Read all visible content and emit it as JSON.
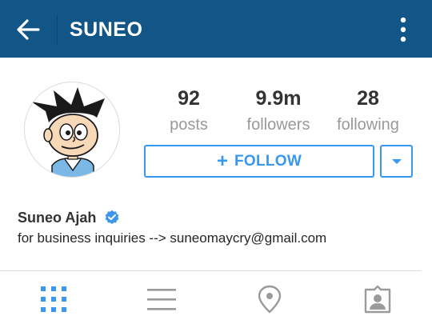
{
  "header": {
    "title": "SUNEO"
  },
  "profile": {
    "stats": [
      {
        "count": "92",
        "label": "posts"
      },
      {
        "count": "9.9m",
        "label": "followers"
      },
      {
        "count": "28",
        "label": "following"
      }
    ],
    "follow_label": "FOLLOW",
    "follow_plus": "+",
    "name": "Suneo Ajah",
    "verified": true,
    "bio": "for business inquiries --> suneomaycry@gmail.com"
  },
  "tabs": [
    {
      "icon": "grid-icon",
      "selected": true
    },
    {
      "icon": "list-icon",
      "selected": false
    },
    {
      "icon": "location-pin-icon",
      "selected": false
    },
    {
      "icon": "tagged-photos-icon",
      "selected": false
    }
  ],
  "colors": {
    "header_bg": "#125688",
    "accent": "#3897f0",
    "muted": "#999999",
    "inactive_icon": "#9a9a9a"
  }
}
